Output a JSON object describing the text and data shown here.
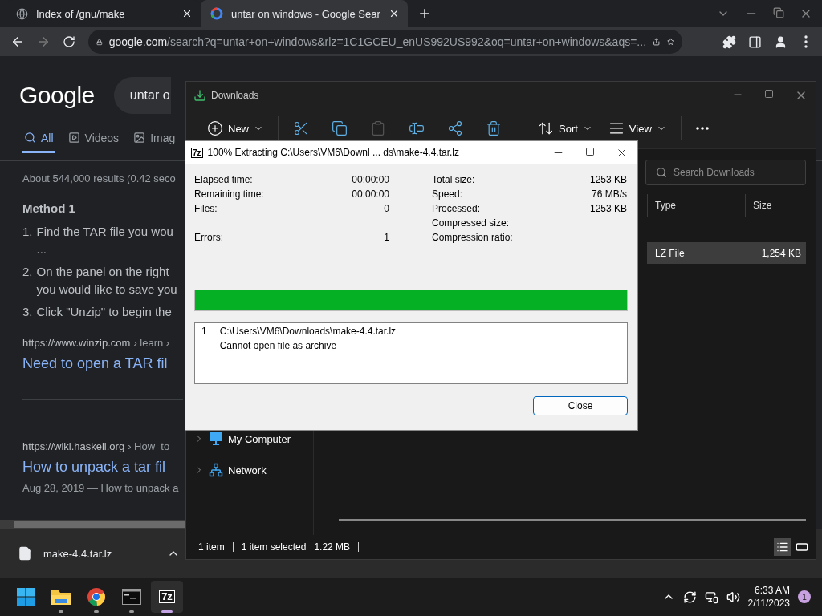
{
  "browser": {
    "tabs": [
      {
        "title": "Index of /gnu/make",
        "selected": false
      },
      {
        "title": "untar on windows - Google Sear",
        "selected": true
      }
    ],
    "address": "**google.com**/search?q=untar+on+windows&rlz=1C1GCEU_enUS992US992&oq=untar+on+windows&aqs=..."
  },
  "google": {
    "logo": "Google",
    "query": "untar o",
    "tabs": [
      {
        "label": "All",
        "selected": true
      },
      {
        "label": "Videos",
        "selected": false
      },
      {
        "label": "Imag",
        "selected": false
      }
    ],
    "stats": "About 544,000 results (0.42 seco",
    "heading": "Method 1",
    "steps": [
      {
        "number": "1.",
        "lines": [
          "Find the TAR file you wou",
          "..."
        ]
      },
      {
        "number": "2.",
        "lines": [
          "On the panel on the right",
          "you would like to save you"
        ]
      },
      {
        "number": "3.",
        "lines": [
          "Click \"Unzip\" to begin the"
        ]
      }
    ],
    "results": [
      {
        "url": "https://www.winzip.com",
        "path": "› learn ›",
        "title": "Need to open a TAR fil"
      },
      {
        "url": "https://wiki.haskell.org",
        "path": "› How_to_",
        "title": "How to unpack a tar fil",
        "snippet": "Aug 28, 2019 — How to unpack a"
      }
    ]
  },
  "download_shelf": {
    "file": "make-4.4.tar.lz"
  },
  "explorer": {
    "title": "Downloads",
    "toolbar": [
      {
        "kind": "new",
        "label": "New",
        "disabled": false
      },
      {
        "kind": "cut",
        "disabled": false
      },
      {
        "kind": "copy",
        "disabled": false
      },
      {
        "kind": "paste",
        "disabled": true
      },
      {
        "kind": "rename",
        "disabled": false
      },
      {
        "kind": "share",
        "disabled": false
      },
      {
        "kind": "delete",
        "disabled": false
      },
      {
        "kind": "sort",
        "label": "Sort",
        "disabled": false
      },
      {
        "kind": "view",
        "label": "View",
        "disabled": false
      },
      {
        "kind": "more",
        "disabled": false
      }
    ],
    "search": {
      "placeholder": "Search Downloads"
    },
    "columns": [
      "Type",
      "Size"
    ],
    "rows": [
      {
        "type": "LZ File",
        "size": "1,254 KB",
        "selected": true
      }
    ],
    "nav": [
      {
        "label": "My Computer"
      },
      {
        "label": "Network"
      }
    ],
    "status": {
      "count": "1 item",
      "selection": "1 item selected",
      "size": "1.22 MB"
    },
    "views": [
      {
        "kind": "details",
        "selected": true
      },
      {
        "kind": "tiles",
        "selected": false
      }
    ]
  },
  "dialog": {
    "icon_label": "7z",
    "title": "100% Extracting C:\\Users\\VM6\\Downl ... ds\\make-4.4.tar.lz",
    "left_stats": [
      {
        "label": "Elapsed time:",
        "value": "00:00:00",
        "kind": "plain"
      },
      {
        "label": "Remaining time:",
        "value": "00:00:00",
        "kind": "plain"
      },
      {
        "label": "Files:",
        "value": "0",
        "kind": "plain"
      },
      {
        "label": "Errors:",
        "value": "1",
        "kind": "separated"
      }
    ],
    "right_stats": [
      {
        "label": "Total size:",
        "value": "1253 KB"
      },
      {
        "label": "Speed:",
        "value": "76 MB/s"
      },
      {
        "label": "Processed:",
        "value": "1253 KB"
      },
      {
        "label": "Compressed size:"
      },
      {
        "label": "Compression ratio:"
      }
    ],
    "progress": {
      "level": 1
    },
    "messages": [
      {
        "number": "1",
        "path": "C:\\Users\\VM6\\Downloads\\make-4.4.tar.lz",
        "text": "Cannot open file as archive"
      }
    ],
    "close_button": "Close"
  },
  "taskbar": {
    "apps": [
      {
        "kind": "start",
        "running": false,
        "selected": false
      },
      {
        "kind": "explorer",
        "running": true,
        "selected": false
      },
      {
        "kind": "browser",
        "running": true,
        "selected": false
      },
      {
        "kind": "terminal",
        "running": true,
        "selected": false
      },
      {
        "kind": "archiver",
        "label": "7z",
        "running": true,
        "selected": true
      }
    ],
    "time": "6:33 AM",
    "date": "2/11/2023",
    "notifications": "1"
  }
}
